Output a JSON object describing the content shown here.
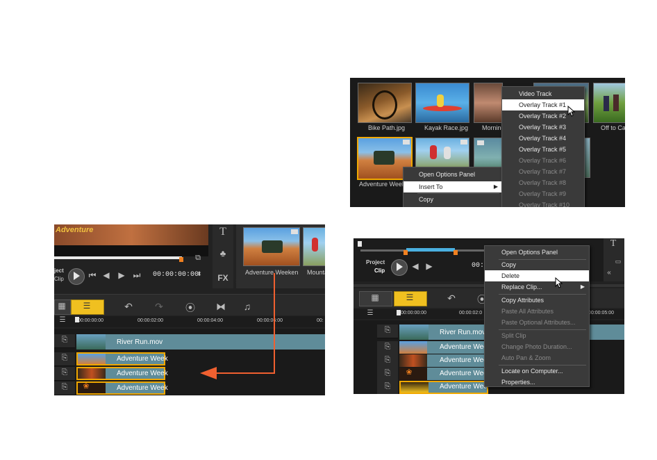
{
  "library": {
    "thumbs": [
      "Bike Path.jpg",
      "Kayak Race.jpg",
      "Morning",
      "Off to Cam",
      "Adventure Weeke"
    ],
    "context_menu": [
      "Open Options Panel",
      "Insert To",
      "Copy"
    ],
    "insert_submenu": [
      "Video Track",
      "Overlay Track #1",
      "Overlay Track #2",
      "Overlay Track #3",
      "Overlay Track #4",
      "Overlay Track #5",
      "Overlay Track #6",
      "Overlay Track #7",
      "Overlay Track #8",
      "Overlay Track #9",
      "Overlay Track #10"
    ]
  },
  "drag": {
    "preview_title": "Adventure",
    "timecode": "00:00:00:00",
    "library_thumbs": [
      "Adventure Weeken",
      "Mounta"
    ],
    "ruler": [
      "00:00:00:00",
      "00:00:02:00",
      "00:00:04:00",
      "00:00:06:00",
      "00:"
    ],
    "project_label": "ject",
    "clip_label": "Clip",
    "fx_label": "FX",
    "video_clip": "River Run.mov",
    "overlay_clips": [
      "Adventure Week",
      "Adventure Week",
      "Adventure Week"
    ]
  },
  "timeline": {
    "project_label": "Project",
    "clip_label": "Clip",
    "timecode": "00:",
    "ruler": [
      "00:00:00:00",
      "00:00:02:0",
      "00:00:05:00"
    ],
    "video_clip": "River Run.mov",
    "overlay_clips": [
      "Adventure Wee",
      "Adventure Wee",
      "Adventure Wee",
      "Adventure Wee"
    ],
    "context_menu": [
      "Open Options Panel",
      "Copy",
      "Delete",
      "Replace Clip...",
      "Copy Attributes",
      "Paste All Attributes",
      "Paste Optional Attributes...",
      "Split Clip",
      "Change Photo Duration...",
      "Auto Pan & Zoom",
      "Locate on Computer...",
      "Properties..."
    ]
  },
  "colors": {
    "highlight": "#ffffff",
    "selection": "#f0a800",
    "arrow": "#f06030",
    "clip": "#5f8c99"
  }
}
